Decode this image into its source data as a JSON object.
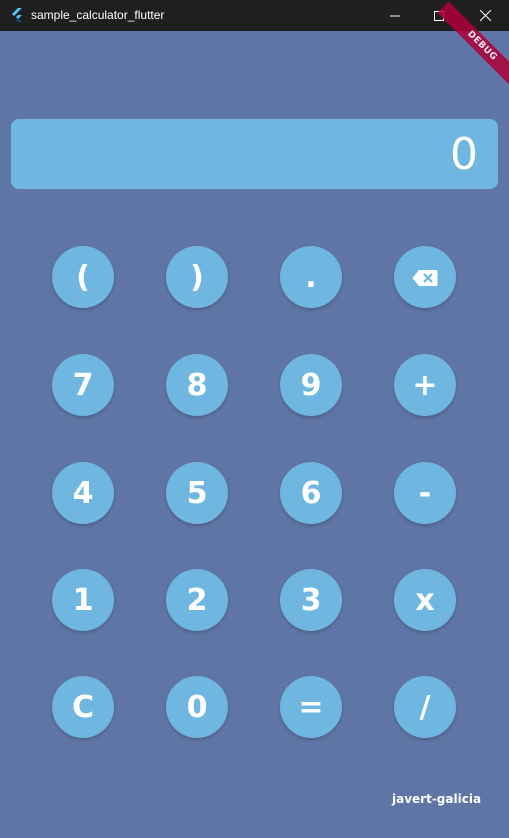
{
  "window": {
    "title": "sample_calculator_flutter",
    "controls": {
      "minimize_icon": "minimize-icon",
      "maximize_icon": "maximize-icon",
      "close_icon": "close-icon"
    }
  },
  "debug_banner": "DEBUG",
  "display": {
    "value": "0"
  },
  "keys": [
    [
      "(",
      ")",
      ".",
      "backspace"
    ],
    [
      "7",
      "8",
      "9",
      "+"
    ],
    [
      "4",
      "5",
      "6",
      "-"
    ],
    [
      "1",
      "2",
      "3",
      "x"
    ],
    [
      "C",
      "0",
      "=",
      "/"
    ]
  ],
  "footer": {
    "author": "javert-galicia"
  },
  "colors": {
    "background": "#5f75a5",
    "accent": "#6fb7e0",
    "titlebar": "#1f1f1f",
    "debug": "#b0003a"
  }
}
